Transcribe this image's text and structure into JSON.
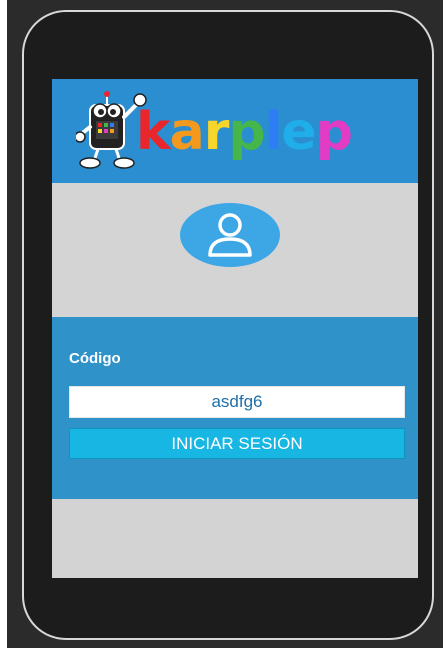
{
  "app": {
    "logo_text": [
      "k",
      "a",
      "r",
      "p",
      "l",
      "e",
      "p"
    ],
    "logo_colors": [
      "#e8262b",
      "#f39a1e",
      "#f7d52b",
      "#45b649",
      "#2e7cf6",
      "#1faee9",
      "#e23cc4"
    ]
  },
  "login": {
    "code_label": "Código",
    "code_value": "asdfg6",
    "submit_label": "INICIAR SESIÓN"
  },
  "colors": {
    "header": "#2a8ed0",
    "panel": "#2f92c9",
    "button": "#17b6e3",
    "avatar": "#3da7e6"
  }
}
